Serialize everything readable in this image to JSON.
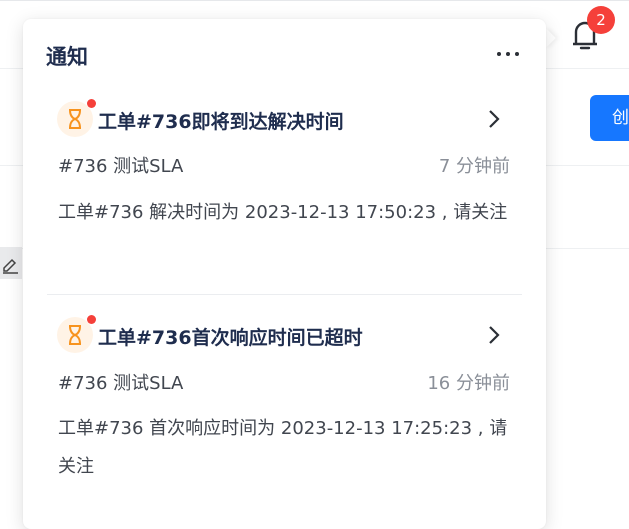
{
  "background": {
    "create_button_label": "创"
  },
  "bell": {
    "badge_count": "2"
  },
  "panel": {
    "title": "通知",
    "items": [
      {
        "title": "工单#736即将到达解决时间",
        "meta": "#736  测试SLA",
        "time": "7 分钟前",
        "body": "工单#736 解决时间为 2023-12-13 17:50:23 , 请关注",
        "unread": true,
        "icon": "hourglass-icon"
      },
      {
        "title": "工单#736首次响应时间已超时",
        "meta": "#736  测试SLA",
        "time": "16 分钟前",
        "body": "工单#736 首次响应时间为 2023-12-13 17:25:23 , 请关注",
        "unread": true,
        "icon": "hourglass-icon"
      }
    ]
  },
  "colors": {
    "accent": "#1677ff",
    "badge": "#f5403a",
    "hourglass": "#f7931e",
    "icon_bg": "#fff3e6"
  }
}
